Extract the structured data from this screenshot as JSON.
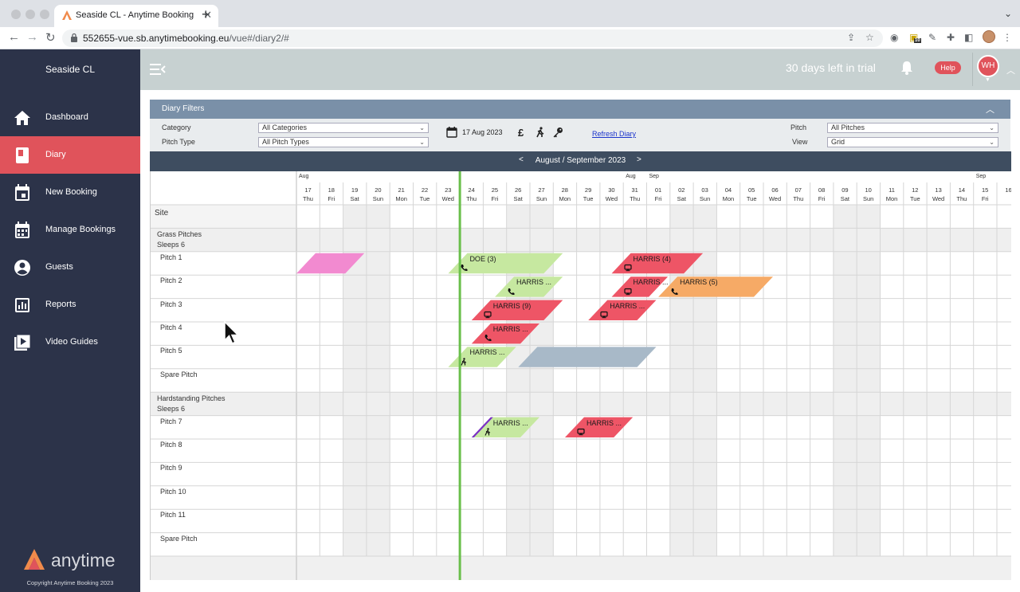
{
  "browser": {
    "tab_title": "Seaside CL - Anytime Booking",
    "url_host": "552655-vue.sb.anytimebooking.eu",
    "url_path": "/vue#/diary2/#",
    "extension_badge": "10"
  },
  "sidebar": {
    "site_name": "Seaside CL",
    "items": [
      {
        "label": "Dashboard",
        "icon": "home-icon",
        "active": false
      },
      {
        "label": "Diary",
        "icon": "book-icon",
        "active": true
      },
      {
        "label": "New Booking",
        "icon": "calendar-icon",
        "active": false
      },
      {
        "label": "Manage Bookings",
        "icon": "calendar-grid-icon",
        "active": false
      },
      {
        "label": "Guests",
        "icon": "user-icon",
        "active": false
      },
      {
        "label": "Reports",
        "icon": "chart-icon",
        "active": false
      },
      {
        "label": "Video Guides",
        "icon": "video-icon",
        "active": false
      }
    ],
    "logo_text": "anytime",
    "copyright": "Copyright Anytime Booking 2023"
  },
  "header": {
    "trial_text": "30 days left in trial",
    "help_label": "Help",
    "avatar_initials": "WH"
  },
  "filters": {
    "title": "Diary Filters",
    "category_label": "Category",
    "category_value": "All Categories",
    "pitch_type_label": "Pitch Type",
    "pitch_type_value": "All Pitch Types",
    "date": "17 Aug 2023",
    "currency_symbol": "£",
    "refresh_label": "Refresh Diary",
    "pitch_label": "Pitch",
    "pitch_value": "All Pitches",
    "view_label": "View",
    "view_value": "Grid"
  },
  "diary": {
    "month_label": "August / September 2023",
    "prev": "<",
    "next": ">",
    "site_label": "Site",
    "month_markers": [
      {
        "label": "Aug",
        "col": 0
      },
      {
        "label": "Aug",
        "col": 14
      },
      {
        "label": "Sep",
        "col": 15
      },
      {
        "label": "Sep",
        "col": 29
      }
    ],
    "days": [
      {
        "d": "17",
        "w": "Thu"
      },
      {
        "d": "18",
        "w": "Fri"
      },
      {
        "d": "19",
        "w": "Sat"
      },
      {
        "d": "20",
        "w": "Sun"
      },
      {
        "d": "21",
        "w": "Mon"
      },
      {
        "d": "22",
        "w": "Tue"
      },
      {
        "d": "23",
        "w": "Wed"
      },
      {
        "d": "24",
        "w": "Thu"
      },
      {
        "d": "25",
        "w": "Fri"
      },
      {
        "d": "26",
        "w": "Sat"
      },
      {
        "d": "27",
        "w": "Sun"
      },
      {
        "d": "28",
        "w": "Mon"
      },
      {
        "d": "29",
        "w": "Tue"
      },
      {
        "d": "30",
        "w": "Wed"
      },
      {
        "d": "31",
        "w": "Thu"
      },
      {
        "d": "01",
        "w": "Fri"
      },
      {
        "d": "02",
        "w": "Sat"
      },
      {
        "d": "03",
        "w": "Sun"
      },
      {
        "d": "04",
        "w": "Mon"
      },
      {
        "d": "05",
        "w": "Tue"
      },
      {
        "d": "06",
        "w": "Wed"
      },
      {
        "d": "07",
        "w": "Thu"
      },
      {
        "d": "08",
        "w": "Fri"
      },
      {
        "d": "09",
        "w": "Sat"
      },
      {
        "d": "10",
        "w": "Sun"
      },
      {
        "d": "11",
        "w": "Mon"
      },
      {
        "d": "12",
        "w": "Tue"
      },
      {
        "d": "13",
        "w": "Wed"
      },
      {
        "d": "14",
        "w": "Thu"
      },
      {
        "d": "15",
        "w": "Fri"
      },
      {
        "d": "16",
        "w": ""
      }
    ],
    "rows": [
      {
        "type": "group",
        "title": "Grass Pitches",
        "sub": "Sleeps 6"
      },
      {
        "type": "pitch",
        "name": "Pitch 1"
      },
      {
        "type": "pitch",
        "name": "Pitch 2"
      },
      {
        "type": "pitch",
        "name": "Pitch 3"
      },
      {
        "type": "pitch",
        "name": "Pitch 4"
      },
      {
        "type": "pitch",
        "name": "Pitch 5"
      },
      {
        "type": "pitch",
        "name": "Spare Pitch"
      },
      {
        "type": "group",
        "title": "Hardstanding Pitches",
        "sub": "Sleeps 6"
      },
      {
        "type": "pitch",
        "name": "Pitch 7"
      },
      {
        "type": "pitch",
        "name": "Pitch 8"
      },
      {
        "type": "pitch",
        "name": "Pitch 9"
      },
      {
        "type": "pitch",
        "name": "Pitch 10"
      },
      {
        "type": "pitch",
        "name": "Pitch 11"
      },
      {
        "type": "pitch",
        "name": "Spare Pitch"
      }
    ],
    "today_col": 7,
    "bookings": [
      {
        "row": 1,
        "start": 0,
        "end": 2.5,
        "color": "#f28ad0",
        "label": "",
        "icon": ""
      },
      {
        "row": 1,
        "start": 6.5,
        "end": 11,
        "color": "#c6e8a0",
        "label": "DOE (3)",
        "icon": "phone"
      },
      {
        "row": 1,
        "start": 13.5,
        "end": 17,
        "color": "#ee5566",
        "label": "HARRIS (4)",
        "icon": "monitor"
      },
      {
        "row": 2,
        "start": 8.5,
        "end": 11,
        "color": "#c6e8a0",
        "label": "HARRIS ...",
        "icon": "phone"
      },
      {
        "row": 2,
        "start": 13.5,
        "end": 15.5,
        "color": "#ee5566",
        "label": "HARRIS ...",
        "icon": "monitor"
      },
      {
        "row": 2,
        "start": 15.5,
        "end": 20,
        "color": "#f6aa66",
        "label": "HARRIS (5)",
        "icon": "phone"
      },
      {
        "row": 3,
        "start": 7.5,
        "end": 11,
        "color": "#ee5566",
        "label": "HARRIS (9)",
        "icon": "monitor"
      },
      {
        "row": 3,
        "start": 12.5,
        "end": 15,
        "color": "#ee5566",
        "label": "HARRIS ...",
        "icon": "monitor"
      },
      {
        "row": 4,
        "start": 7.5,
        "end": 10,
        "color": "#ee5566",
        "label": "HARRIS ...",
        "icon": "phone"
      },
      {
        "row": 5,
        "start": 6.5,
        "end": 9,
        "color": "#c6e8a0",
        "label": "HARRIS ...",
        "icon": "walk"
      },
      {
        "row": 5,
        "start": 9.5,
        "end": 15,
        "color": "#a8b9c8",
        "label": "",
        "icon": ""
      },
      {
        "row": 8,
        "start": 7.5,
        "end": 10,
        "color": "#c6e8a0",
        "label": "HARRIS ...",
        "icon": "walk",
        "accent": "#7b2ec6"
      },
      {
        "row": 8,
        "start": 11.5,
        "end": 14,
        "color": "#ee5566",
        "label": "HARRIS ...",
        "icon": "monitor"
      }
    ]
  }
}
